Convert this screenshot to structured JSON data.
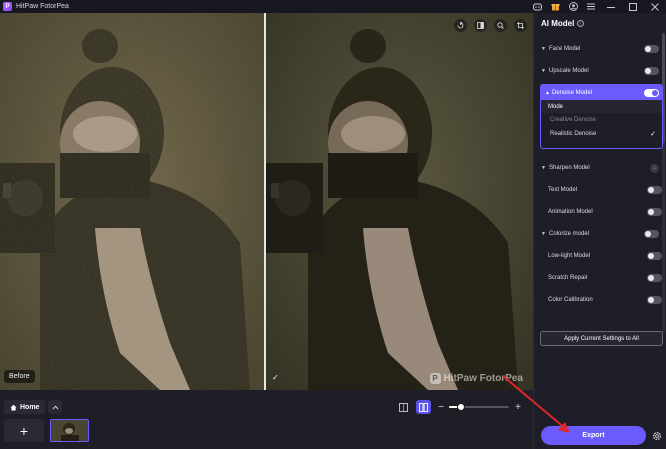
{
  "window": {
    "title": "HitPaw FotorPea",
    "logo_letter": "P",
    "icons": [
      "discord-icon",
      "gift-icon",
      "account-icon",
      "menu-icon",
      "minimize-icon",
      "maximize-icon",
      "close-icon"
    ]
  },
  "viewer": {
    "before_label": "Before",
    "after_badge": "✓",
    "tools": [
      "reset-icon",
      "compare-icon",
      "zoom-icon",
      "crop-icon"
    ],
    "watermark": "HitPaw FotorPea",
    "watermark_logo": "P"
  },
  "bottombar": {
    "home_label": "Home",
    "add_symbol": "+",
    "zoom_minus": "−",
    "zoom_plus": "+",
    "zoom_level": 0.2
  },
  "panel": {
    "title": "AI Model",
    "models": [
      {
        "label": "Face Model",
        "caret": "▼",
        "toggle": false
      },
      {
        "label": "Upscale Model",
        "caret": "▼",
        "toggle": false
      }
    ],
    "denoise": {
      "label": "Denoise Model",
      "caret": "▲",
      "toggle": true,
      "mode_title": "Mode",
      "options": [
        {
          "label": "Creative Denoise",
          "selected": false
        },
        {
          "label": "Realistic Denoise",
          "selected": true
        }
      ]
    },
    "sharpen": {
      "label": "Sharpen Model",
      "caret": "▼"
    },
    "more_models": [
      {
        "label": "Text Model",
        "toggle": false
      },
      {
        "label": "Animation Model",
        "toggle": false
      }
    ],
    "colorize": {
      "label": "Colorize model",
      "caret": "▼"
    },
    "colorize_models": [
      {
        "label": "Low-light Model",
        "toggle": false
      },
      {
        "label": "Scratch Repair",
        "toggle": false
      },
      {
        "label": "Color Calibration",
        "toggle": false
      }
    ],
    "apply_label": "Apply Current Settings to All",
    "export_label": "Export"
  },
  "colors": {
    "accent": "#6b5bff",
    "arrow": "#e0262b"
  }
}
